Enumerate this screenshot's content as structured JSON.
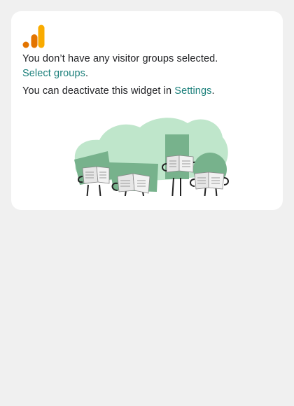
{
  "widget": {
    "message": "You don’t have any visitor groups selected.",
    "select_link": "Select groups",
    "select_suffix": ".",
    "deactivate_prefix": "You can deactivate this widget in ",
    "settings_link": "Settings",
    "settings_suffix": "."
  },
  "colors": {
    "page_bg": "#f0f0f0",
    "card_bg": "#ffffff",
    "text": "#202124",
    "link": "#1a7f7a",
    "logo_light": "#f9ab00",
    "logo_dark": "#e37400",
    "illustration_green": "#77b28c",
    "illustration_light_green": "#bfe6cb"
  },
  "icons": {
    "logo": "analytics-bars-icon",
    "illustration": "people-reading-newspapers-illustration"
  }
}
